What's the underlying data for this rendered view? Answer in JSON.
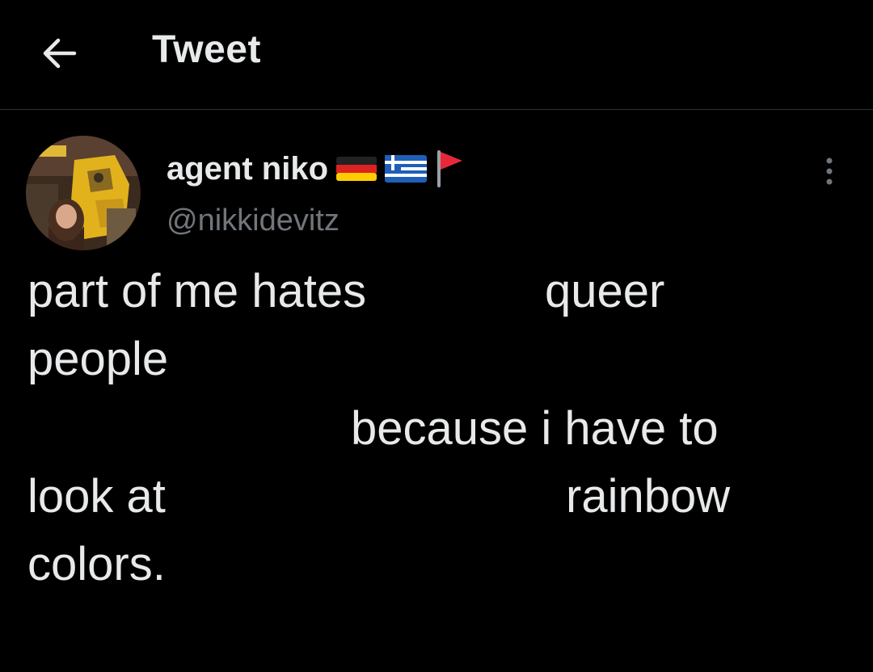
{
  "header": {
    "title": "Tweet",
    "back_icon": "arrow-left-icon"
  },
  "author": {
    "display_name": "agent niko",
    "handle": "@nikkidevitz",
    "name_emojis": [
      "germany-flag",
      "greece-flag",
      "red-flag"
    ],
    "avatar_label": "NKI"
  },
  "tweet": {
    "line1a": "part of me hates",
    "line1b": "queer",
    "line2": "people",
    "line3": "because i have to",
    "line4a": "look at",
    "line4b": "rainbow",
    "line5": "colors."
  },
  "colors": {
    "background": "#000000",
    "text": "#e7e9ea",
    "secondary": "#71767b",
    "divider": "#2f3336"
  }
}
